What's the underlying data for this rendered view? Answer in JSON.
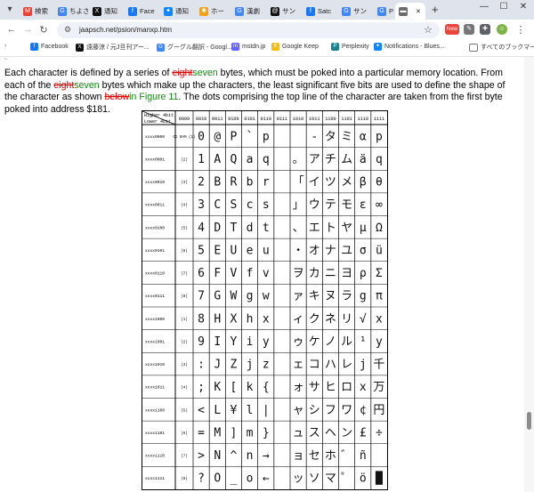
{
  "browser": {
    "tabs": [
      {
        "label": "検索",
        "icon": "gmail-icon",
        "color": "#ea4335",
        "glyph": "M"
      },
      {
        "label": "ちよさ",
        "icon": "google-icon",
        "color": "#4285f4",
        "glyph": "G"
      },
      {
        "label": "通知",
        "icon": "x-icon",
        "color": "#111111",
        "glyph": "X"
      },
      {
        "label": "Face",
        "icon": "facebook-icon",
        "color": "#1877f2",
        "glyph": "f"
      },
      {
        "label": "通知",
        "icon": "bluesky-icon",
        "color": "#1185fe",
        "glyph": "✦"
      },
      {
        "label": "ホー",
        "icon": "misskey-icon",
        "color": "#f4a21c",
        "glyph": "✱"
      },
      {
        "label": "漢劇",
        "icon": "google-icon",
        "color": "#4285f4",
        "glyph": "G"
      },
      {
        "label": "サン",
        "icon": "threads-icon",
        "color": "#111111",
        "glyph": "@"
      },
      {
        "label": "Satc",
        "icon": "facebook-icon",
        "color": "#1877f2",
        "glyph": "f"
      },
      {
        "label": "サン",
        "icon": "google-icon",
        "color": "#4285f4",
        "glyph": "G"
      },
      {
        "label": "Psi",
        "icon": "google-icon",
        "color": "#4285f4",
        "glyph": "G"
      },
      {
        "label": "",
        "icon": "page-icon",
        "color": "#6b6b6b",
        "glyph": "▬",
        "active": true
      }
    ],
    "url": "jaapsch.net/psion/manxp.htm",
    "extension_badge": "New",
    "bookmarks": [
      {
        "label": "Facebook",
        "color": "#1877f2",
        "glyph": "f"
      },
      {
        "label": "遠藤涼 / 元J旦刊アー...",
        "color": "#111111",
        "glyph": "X"
      },
      {
        "label": "グーグル翻訳 - Googl...",
        "color": "#4285f4",
        "glyph": "G"
      },
      {
        "label": "mstdn.jp",
        "color": "#6364ff",
        "glyph": "m"
      },
      {
        "label": "Google Keep",
        "color": "#fbbc04",
        "glyph": "K"
      },
      {
        "label": "Perplexity",
        "color": "#20808d",
        "glyph": "P"
      },
      {
        "label": "Notifications - Blues...",
        "color": "#1185fe",
        "glyph": "✦"
      }
    ],
    "all_bookmarks_label": "すべてのブックマーク"
  },
  "page": {
    "para_1": "Each character is defined by a series of ",
    "del_1": "eight",
    "ins_1": "seven",
    "para_2": " bytes, which must be poked into a particular memory location. From each of the ",
    "del_2": "eight",
    "ins_2": "seven",
    "para_3": " bytes which make up the characters, the least significant five bits are used to define the shape of the character as shown ",
    "del_3": "below",
    "ins_3": "in ",
    "link_text": "Figure 11",
    "para_4": ". The dots comprising the top line of the character are taken from the first byte poked into address $181."
  },
  "char_table": {
    "corner_upper": "Higher 4bit",
    "corner_lower": "Lower 4bit",
    "columns": [
      "0000",
      "0010",
      "0011",
      "0100",
      "0101",
      "0110",
      "0111",
      "1010",
      "1011",
      "1100",
      "1101",
      "1110",
      "1111"
    ],
    "rows": [
      {
        "label": "xxxx0000",
        "cg": "CG RAM (1)"
      },
      {
        "label": "xxxx0001",
        "cg": "(2)"
      },
      {
        "label": "xxxx0010",
        "cg": "(3)"
      },
      {
        "label": "xxxx0011",
        "cg": "(4)"
      },
      {
        "label": "xxxx0100",
        "cg": "(5)"
      },
      {
        "label": "xxxx0101",
        "cg": "(6)"
      },
      {
        "label": "xxxx0110",
        "cg": "(7)"
      },
      {
        "label": "xxxx0111",
        "cg": "(8)"
      },
      {
        "label": "xxxx1000",
        "cg": "(1)"
      },
      {
        "label": "xxxx1001",
        "cg": "(2)"
      },
      {
        "label": "xxxx1010",
        "cg": "(3)"
      },
      {
        "label": "xxxx1011",
        "cg": "(4)"
      },
      {
        "label": "xxxx1100",
        "cg": "(5)"
      },
      {
        "label": "xxxx1101",
        "cg": "(6)"
      },
      {
        "label": "xxxx1110",
        "cg": "(7)"
      },
      {
        "label": "xxxx1111",
        "cg": "(8)"
      }
    ],
    "glyphs": [
      [
        " ",
        "0",
        "@",
        "P",
        "`",
        "p",
        " ",
        " ",
        "-",
        "タ",
        "ミ",
        "α",
        "p"
      ],
      [
        "!",
        "1",
        "A",
        "Q",
        "a",
        "q",
        " ",
        "。",
        "ア",
        "チ",
        "ム",
        "ä",
        "q"
      ],
      [
        "\"",
        "2",
        "B",
        "R",
        "b",
        "r",
        " ",
        "「",
        "イ",
        "ツ",
        "メ",
        "β",
        "θ"
      ],
      [
        "#",
        "3",
        "C",
        "S",
        "c",
        "s",
        " ",
        "」",
        "ウ",
        "テ",
        "モ",
        "ε",
        "∞"
      ],
      [
        "$",
        "4",
        "D",
        "T",
        "d",
        "t",
        " ",
        "、",
        "エ",
        "ト",
        "ヤ",
        "μ",
        "Ω"
      ],
      [
        "%",
        "5",
        "E",
        "U",
        "e",
        "u",
        " ",
        "・",
        "オ",
        "ナ",
        "ユ",
        "σ",
        "ü"
      ],
      [
        "&",
        "6",
        "F",
        "V",
        "f",
        "v",
        " ",
        "ヲ",
        "カ",
        "ニ",
        "ヨ",
        "ρ",
        "Σ"
      ],
      [
        "'",
        "7",
        "G",
        "W",
        "g",
        "w",
        " ",
        "ァ",
        "キ",
        "ヌ",
        "ラ",
        "g",
        "π"
      ],
      [
        "(",
        "8",
        "H",
        "X",
        "h",
        "x",
        " ",
        "ィ",
        "ク",
        "ネ",
        "リ",
        "√",
        "x"
      ],
      [
        ")",
        "9",
        "I",
        "Y",
        "i",
        "y",
        " ",
        "ゥ",
        "ケ",
        "ノ",
        "ル",
        "¹",
        "y"
      ],
      [
        "*",
        ":",
        "J",
        "Z",
        "j",
        "z",
        " ",
        "ェ",
        "コ",
        "ハ",
        "レ",
        "j",
        "千"
      ],
      [
        "+",
        ";",
        "K",
        "[",
        "k",
        "{",
        " ",
        "ォ",
        "サ",
        "ヒ",
        "ロ",
        "x",
        "万"
      ],
      [
        ",",
        "<",
        "L",
        "¥",
        "l",
        "|",
        " ",
        "ャ",
        "シ",
        "フ",
        "ワ",
        "¢",
        "円"
      ],
      [
        "-",
        "=",
        "M",
        "]",
        "m",
        "}",
        " ",
        "ュ",
        "ス",
        "ヘ",
        "ン",
        "£",
        "÷"
      ],
      [
        ".",
        ">",
        "N",
        "^",
        "n",
        "→",
        " ",
        "ョ",
        "セ",
        "ホ",
        "゛",
        "ñ",
        " "
      ],
      [
        "/",
        "?",
        "O",
        "_",
        "o",
        "←",
        " ",
        "ッ",
        "ソ",
        "マ",
        "゜",
        "ö",
        "█"
      ]
    ]
  }
}
